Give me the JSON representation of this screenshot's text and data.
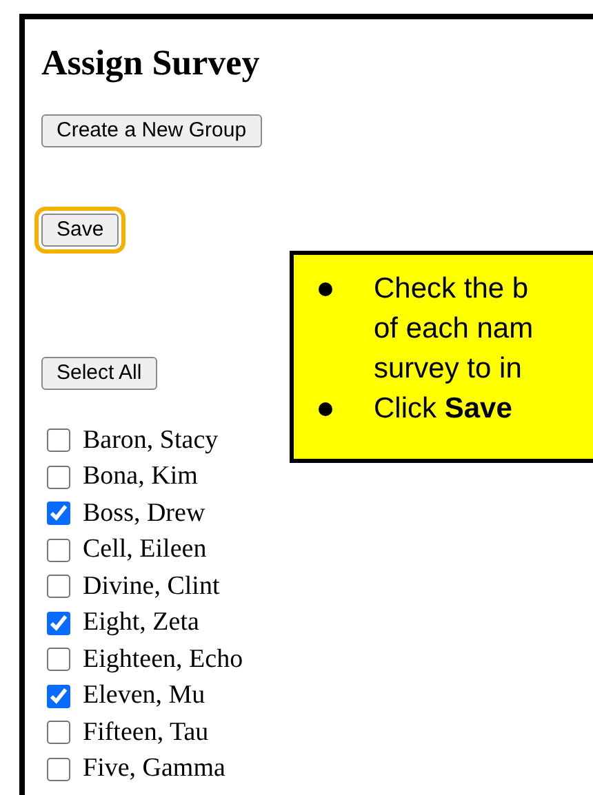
{
  "title": "Assign Survey",
  "buttons": {
    "create_group": "Create a New Group",
    "save": {
      "label": "Save",
      "highlighted": true
    },
    "select_all": "Select All"
  },
  "callout": {
    "items": [
      {
        "lines": [
          "Check the b",
          "of each nam",
          "survey to in"
        ]
      },
      {
        "lines": [
          "Click **Save**"
        ]
      }
    ]
  },
  "people": [
    {
      "name": "Baron, Stacy",
      "checked": false
    },
    {
      "name": "Bona, Kim",
      "checked": false
    },
    {
      "name": "Boss, Drew",
      "checked": true
    },
    {
      "name": "Cell, Eileen",
      "checked": false
    },
    {
      "name": "Divine, Clint",
      "checked": false
    },
    {
      "name": "Eight, Zeta",
      "checked": true
    },
    {
      "name": "Eighteen, Echo",
      "checked": false
    },
    {
      "name": "Eleven, Mu",
      "checked": true
    },
    {
      "name": "Fifteen, Tau",
      "checked": false
    },
    {
      "name": "Five, Gamma",
      "checked": false
    }
  ]
}
